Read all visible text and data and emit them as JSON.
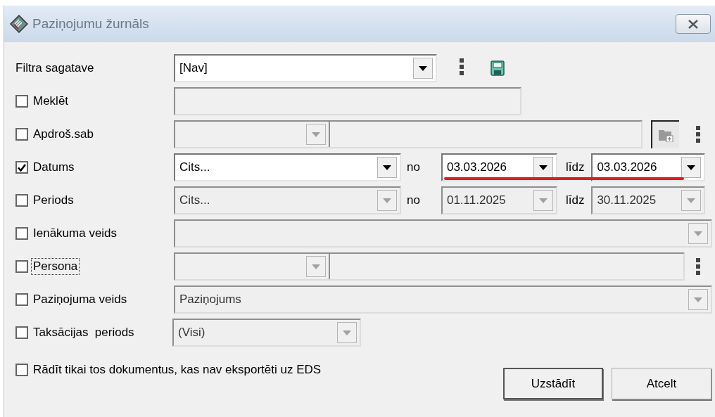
{
  "window": {
    "title": "Paziņojumu žurnāls"
  },
  "rows": [
    {
      "kind": "template",
      "label": "Filtra sagatave",
      "value": "[Nav]",
      "disabled": false
    },
    {
      "kind": "text",
      "label": "Meklēt",
      "checked": false,
      "disabled": true
    },
    {
      "kind": "lookup",
      "label": "Apdroš.sab",
      "checked": false,
      "disabled": true,
      "focused": false,
      "add_button": true
    },
    {
      "kind": "daterange",
      "label": "Datums",
      "checked": true,
      "disabled": false,
      "preset": "Cits...",
      "from_label": "no",
      "from": "03.03.2026",
      "to_label": "līdz",
      "to": "03.03.2026",
      "marked": true
    },
    {
      "kind": "daterange",
      "label": "Periods",
      "checked": false,
      "disabled": true,
      "preset": "Cits...",
      "from_label": "no",
      "from": "01.11.2025",
      "to_label": "līdz",
      "to": "30.11.2025",
      "marked": false
    },
    {
      "kind": "combo",
      "label": "Ienākuma veids",
      "checked": false,
      "disabled": true
    },
    {
      "kind": "lookup",
      "label": "Persona",
      "checked": false,
      "disabled": true,
      "focused": true,
      "add_button": false
    },
    {
      "kind": "combo",
      "label": "Paziņojuma veids",
      "checked": false,
      "disabled": true,
      "value": "Paziņojums"
    },
    {
      "kind": "short_combo",
      "label": "Taksācijas  periods",
      "checked": false,
      "disabled": true,
      "value": "(Visi)"
    },
    {
      "kind": "checkbox",
      "label": "Rādīt tikai tos dokumentus, kas nav eksportēti uz EDS",
      "checked": false
    }
  ],
  "buttons": [
    {
      "label": "Uzstādīt",
      "default": true
    },
    {
      "label": "Atcelt",
      "default": false
    }
  ]
}
